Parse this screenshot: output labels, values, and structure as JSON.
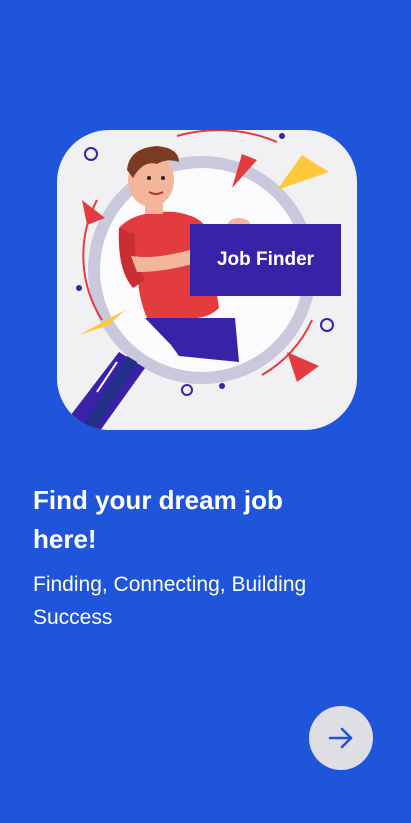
{
  "onboarding": {
    "illustration_tag": "Job Finder",
    "headline": "Find your dream job here!",
    "subtitle": "Finding, Connecting, Building Success"
  },
  "icons": {
    "illustration": "person-with-magnifying-glass-illustration",
    "next": "arrow-right-icon"
  },
  "colors": {
    "background": "#1F55DA",
    "card": "#F1F1F3",
    "tag": "#3A22A8",
    "button": "#DEDEE4",
    "arrow": "#1F55DA"
  }
}
